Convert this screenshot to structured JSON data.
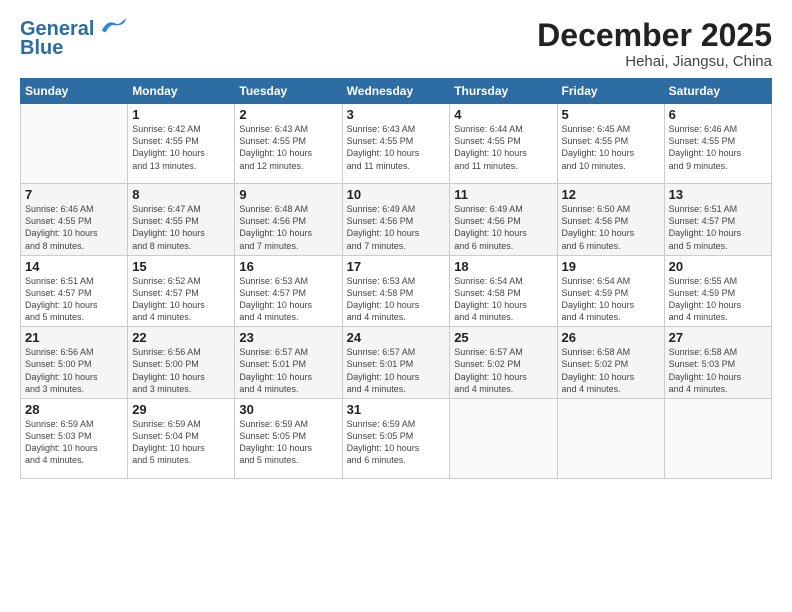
{
  "logo": {
    "line1": "General",
    "line2": "Blue"
  },
  "header": {
    "month": "December 2025",
    "location": "Hehai, Jiangsu, China"
  },
  "days_of_week": [
    "Sunday",
    "Monday",
    "Tuesday",
    "Wednesday",
    "Thursday",
    "Friday",
    "Saturday"
  ],
  "weeks": [
    [
      {
        "day": "",
        "info": ""
      },
      {
        "day": "1",
        "info": "Sunrise: 6:42 AM\nSunset: 4:55 PM\nDaylight: 10 hours\nand 13 minutes."
      },
      {
        "day": "2",
        "info": "Sunrise: 6:43 AM\nSunset: 4:55 PM\nDaylight: 10 hours\nand 12 minutes."
      },
      {
        "day": "3",
        "info": "Sunrise: 6:43 AM\nSunset: 4:55 PM\nDaylight: 10 hours\nand 11 minutes."
      },
      {
        "day": "4",
        "info": "Sunrise: 6:44 AM\nSunset: 4:55 PM\nDaylight: 10 hours\nand 11 minutes."
      },
      {
        "day": "5",
        "info": "Sunrise: 6:45 AM\nSunset: 4:55 PM\nDaylight: 10 hours\nand 10 minutes."
      },
      {
        "day": "6",
        "info": "Sunrise: 6:46 AM\nSunset: 4:55 PM\nDaylight: 10 hours\nand 9 minutes."
      }
    ],
    [
      {
        "day": "7",
        "info": "Sunrise: 6:46 AM\nSunset: 4:55 PM\nDaylight: 10 hours\nand 8 minutes."
      },
      {
        "day": "8",
        "info": "Sunrise: 6:47 AM\nSunset: 4:55 PM\nDaylight: 10 hours\nand 8 minutes."
      },
      {
        "day": "9",
        "info": "Sunrise: 6:48 AM\nSunset: 4:56 PM\nDaylight: 10 hours\nand 7 minutes."
      },
      {
        "day": "10",
        "info": "Sunrise: 6:49 AM\nSunset: 4:56 PM\nDaylight: 10 hours\nand 7 minutes."
      },
      {
        "day": "11",
        "info": "Sunrise: 6:49 AM\nSunset: 4:56 PM\nDaylight: 10 hours\nand 6 minutes."
      },
      {
        "day": "12",
        "info": "Sunrise: 6:50 AM\nSunset: 4:56 PM\nDaylight: 10 hours\nand 6 minutes."
      },
      {
        "day": "13",
        "info": "Sunrise: 6:51 AM\nSunset: 4:57 PM\nDaylight: 10 hours\nand 5 minutes."
      }
    ],
    [
      {
        "day": "14",
        "info": "Sunrise: 6:51 AM\nSunset: 4:57 PM\nDaylight: 10 hours\nand 5 minutes."
      },
      {
        "day": "15",
        "info": "Sunrise: 6:52 AM\nSunset: 4:57 PM\nDaylight: 10 hours\nand 4 minutes."
      },
      {
        "day": "16",
        "info": "Sunrise: 6:53 AM\nSunset: 4:57 PM\nDaylight: 10 hours\nand 4 minutes."
      },
      {
        "day": "17",
        "info": "Sunrise: 6:53 AM\nSunset: 4:58 PM\nDaylight: 10 hours\nand 4 minutes."
      },
      {
        "day": "18",
        "info": "Sunrise: 6:54 AM\nSunset: 4:58 PM\nDaylight: 10 hours\nand 4 minutes."
      },
      {
        "day": "19",
        "info": "Sunrise: 6:54 AM\nSunset: 4:59 PM\nDaylight: 10 hours\nand 4 minutes."
      },
      {
        "day": "20",
        "info": "Sunrise: 6:55 AM\nSunset: 4:59 PM\nDaylight: 10 hours\nand 4 minutes."
      }
    ],
    [
      {
        "day": "21",
        "info": "Sunrise: 6:56 AM\nSunset: 5:00 PM\nDaylight: 10 hours\nand 3 minutes."
      },
      {
        "day": "22",
        "info": "Sunrise: 6:56 AM\nSunset: 5:00 PM\nDaylight: 10 hours\nand 3 minutes."
      },
      {
        "day": "23",
        "info": "Sunrise: 6:57 AM\nSunset: 5:01 PM\nDaylight: 10 hours\nand 4 minutes."
      },
      {
        "day": "24",
        "info": "Sunrise: 6:57 AM\nSunset: 5:01 PM\nDaylight: 10 hours\nand 4 minutes."
      },
      {
        "day": "25",
        "info": "Sunrise: 6:57 AM\nSunset: 5:02 PM\nDaylight: 10 hours\nand 4 minutes."
      },
      {
        "day": "26",
        "info": "Sunrise: 6:58 AM\nSunset: 5:02 PM\nDaylight: 10 hours\nand 4 minutes."
      },
      {
        "day": "27",
        "info": "Sunrise: 6:58 AM\nSunset: 5:03 PM\nDaylight: 10 hours\nand 4 minutes."
      }
    ],
    [
      {
        "day": "28",
        "info": "Sunrise: 6:59 AM\nSunset: 5:03 PM\nDaylight: 10 hours\nand 4 minutes."
      },
      {
        "day": "29",
        "info": "Sunrise: 6:59 AM\nSunset: 5:04 PM\nDaylight: 10 hours\nand 5 minutes."
      },
      {
        "day": "30",
        "info": "Sunrise: 6:59 AM\nSunset: 5:05 PM\nDaylight: 10 hours\nand 5 minutes."
      },
      {
        "day": "31",
        "info": "Sunrise: 6:59 AM\nSunset: 5:05 PM\nDaylight: 10 hours\nand 6 minutes."
      },
      {
        "day": "",
        "info": ""
      },
      {
        "day": "",
        "info": ""
      },
      {
        "day": "",
        "info": ""
      }
    ]
  ]
}
